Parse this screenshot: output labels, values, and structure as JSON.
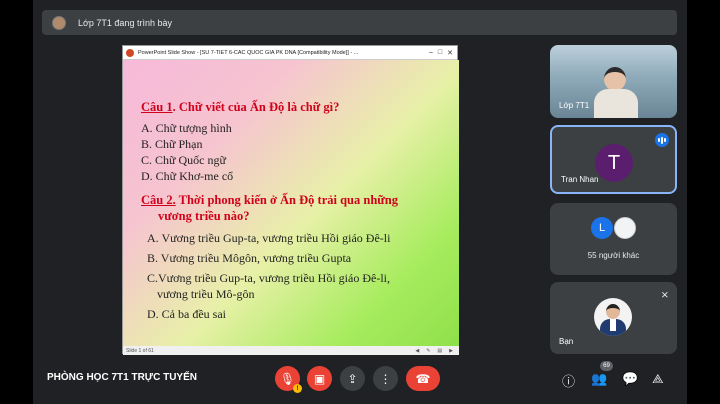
{
  "presenter": {
    "text": "Lớp 7T1 đang trình bày"
  },
  "ppt": {
    "window_title": "PowerPoint Slide Show - [SU 7-TIET 6-CAC QUOC GIA PK DNA [Compatibility Mode]] - ...",
    "minimize": "–",
    "maximize": "□",
    "close": "✕",
    "slide_counter": "Slide 1 of 61"
  },
  "slide": {
    "q1_prefix": "Câu 1",
    "q1_text": ". Chữ viết của Ấn Độ là chữ gì?",
    "q1_options": [
      "A.  Chữ tượng hình",
      "B.   Chữ Phạn",
      "C.   Chữ Quốc ngữ",
      "D.   Chữ Khơ-me cổ"
    ],
    "q2_prefix": "Câu 2.",
    "q2_line1": " Thời phong kiến ở Ấn Độ trải qua những",
    "q2_line2": "vương triều nào?",
    "q2_options": [
      "A. Vương triều Gup-ta, vương triều Hồi giáo Đê-li",
      "B. Vương triều Môgôn, vương triều Gupta",
      "C.Vương triều Gup-ta, vương triều Hồi giáo Đê-li,",
      "vương triều Mô-gôn",
      "D. Cả ba đều sai"
    ]
  },
  "tiles": {
    "presenter_label": "Lớp 7T1",
    "participant": {
      "initial": "T",
      "name": "Tran Nhan",
      "avatar_color": "#5b1e6e"
    },
    "others": {
      "initial": "L",
      "text": "55 người khác"
    },
    "self_label": "Bạn"
  },
  "footer": {
    "room_name": "PHÒNG HỌC 7T1 TRỰC TUYẾN",
    "participant_count": "69",
    "icons": [
      "mic-off-icon",
      "camera-off-icon",
      "present-icon",
      "more-icon",
      "end-call-icon",
      "info-icon",
      "people-icon",
      "chat-icon",
      "activities-icon"
    ]
  }
}
